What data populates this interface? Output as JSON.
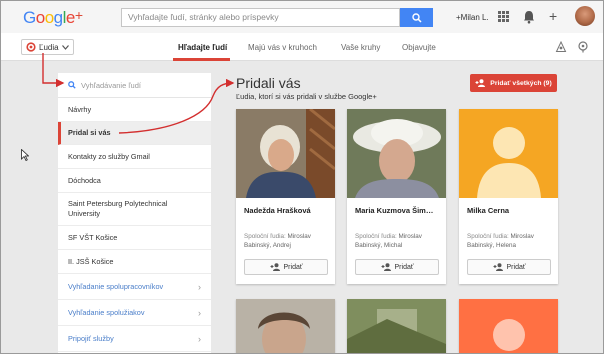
{
  "header": {
    "logo": "Google+",
    "search_placeholder": "Vyhľadajte ľudí, stránky alebo príspevky",
    "user_name": "+Milan L."
  },
  "subnav": {
    "people_dropdown": "Ľudia",
    "tabs": [
      "Hľadajte ľudí",
      "Majú vás v kruhoch",
      "Vaše kruhy",
      "Objavujte"
    ]
  },
  "sidebar": {
    "search_placeholder": "Vyhľadávanie ľudí",
    "items": [
      {
        "label": "Návrhy"
      },
      {
        "label": "Pridal si vás"
      },
      {
        "label": "Kontakty zo služby Gmail"
      },
      {
        "label": "Dóchodca"
      },
      {
        "label": "Saint Petersburg Polytechnical University"
      },
      {
        "label": "SF VŠT Košice"
      },
      {
        "label": "II. JSŠ Košice"
      }
    ],
    "links": [
      {
        "label": "Vyhľadanie spolupracovníkov"
      },
      {
        "label": "Vyhľadanie spolužiakov"
      },
      {
        "label": "Pripojiť služby"
      }
    ]
  },
  "main": {
    "title": "Pridali vás",
    "subtitle": "Ľudia, ktorí si vás pridali v službe Google+",
    "add_all_label": "Pridať všetkých (9)"
  },
  "cards": [
    {
      "name": "Nadežda Hrašková",
      "common_label": "Spoloční ľudia:",
      "common_names": "Miroslav Babinský, Andrej",
      "button": "Pridať"
    },
    {
      "name": "Maria Kuzmova Šim…",
      "common_label": "Spoloční ľudia:",
      "common_names": "Miroslav Babinský, Michal",
      "button": "Pridať"
    },
    {
      "name": "Milka Cerna",
      "common_label": "Spoloční ľudia:",
      "common_names": "Miroslav Babinský, Helena",
      "button": "Pridať"
    }
  ],
  "colors": {
    "accent_red": "#db4437",
    "link_blue": "#4a7ec9",
    "placeholder_orange": "#f5a623"
  }
}
